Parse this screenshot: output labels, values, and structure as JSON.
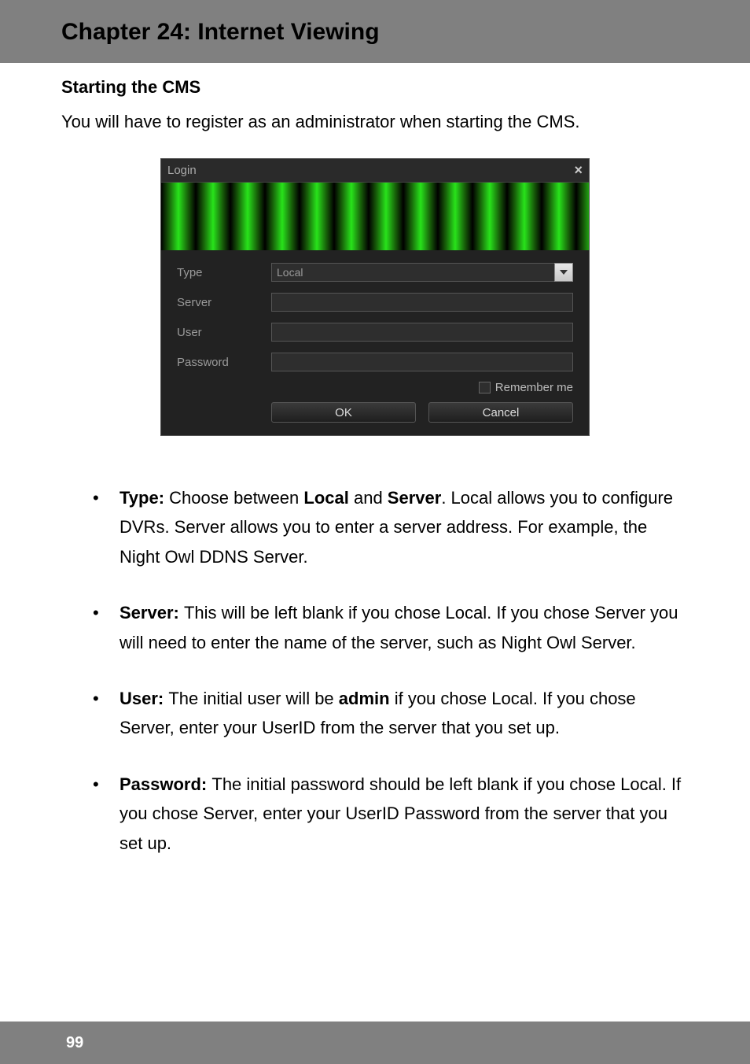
{
  "chapter": {
    "title": "Chapter 24: Internet Viewing"
  },
  "section": {
    "heading": "Starting the CMS"
  },
  "intro": "You will have to register as an administrator when starting the CMS.",
  "login": {
    "title": "Login",
    "close": "×",
    "labels": {
      "type": "Type",
      "server": "Server",
      "user": "User",
      "password": "Password"
    },
    "values": {
      "type": "Local",
      "server": "",
      "user": "",
      "password": ""
    },
    "remember": "Remember me",
    "ok": "OK",
    "cancel": "Cancel"
  },
  "bullets": {
    "type": {
      "prefix": "Type: ",
      "t1": "Choose between ",
      "b1": "Local",
      "t2": " and ",
      "b2": "Server",
      "t3": ". Local allows you to configure DVRs. Server allows you to enter a server address. For example, the Night Owl DDNS Server."
    },
    "server": {
      "prefix": "Server: ",
      "body": "This will be left blank if you chose Local. If you chose Server you will need to enter the name of the server, such as Night Owl Server."
    },
    "user": {
      "prefix": "User: ",
      "t1": "The initial user will be ",
      "b1": "admin",
      "t2": " if you chose Local. If you chose Server, enter your UserID from the server that you set up."
    },
    "password": {
      "prefix": "Password: ",
      "body": "The initial password should be left blank if you chose Local. If you chose Server, enter your UserID Password from the server that you set up."
    }
  },
  "page_number": "99"
}
